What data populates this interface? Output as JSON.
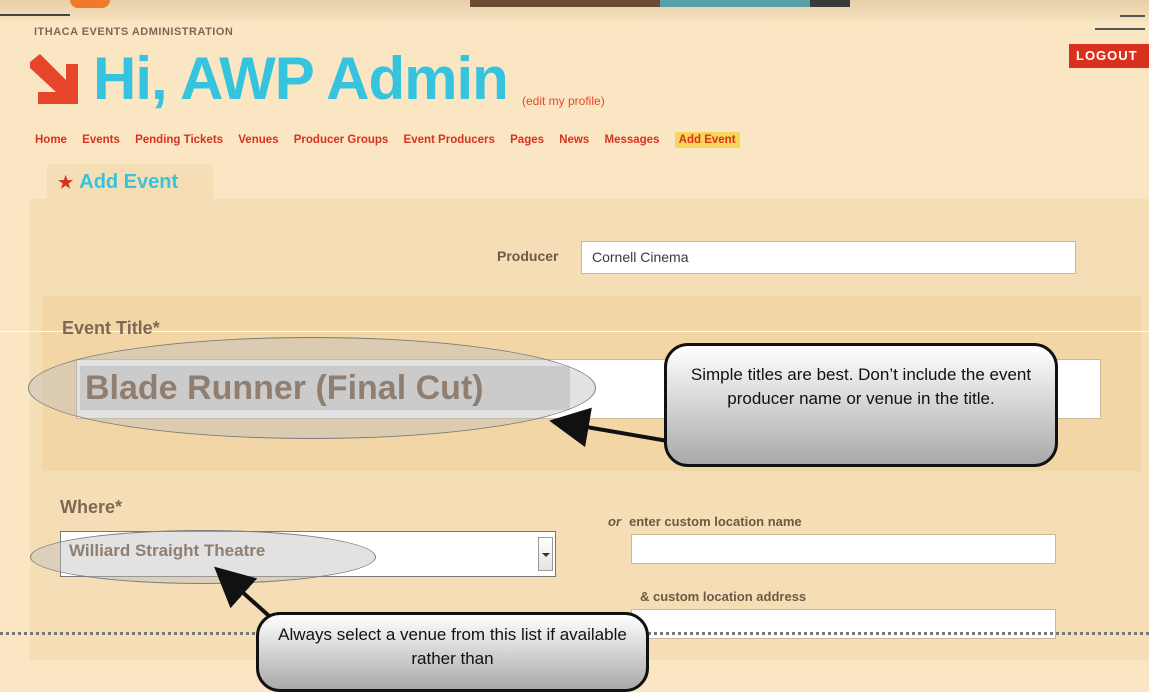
{
  "org_name": "ITHACA EVENTS ADMINISTRATION",
  "logout_label": "LOGOUT",
  "greeting": "Hi, AWP Admin",
  "edit_profile_link": "(edit my profile)",
  "nav": {
    "items": [
      "Home",
      "Events",
      "Pending Tickets",
      "Venues",
      "Producer Groups",
      "Event Producers",
      "Pages",
      "News",
      "Messages"
    ],
    "active": "Add Event"
  },
  "tab": {
    "star": "★",
    "label": "Add Event"
  },
  "form": {
    "producer_label": "Producer",
    "producer_value": "Cornell Cinema",
    "event_title_label": "Event Title*",
    "event_title_value": "Blade Runner (Final Cut)",
    "where_label": "Where*",
    "venue_value": "Williard Straight Theatre",
    "or_word": "or",
    "custom_location_label": "enter custom location name",
    "custom_location_value": "",
    "custom_address_label": "& custom location address",
    "custom_address_value": ""
  },
  "callouts": {
    "title_tip": "Simple titles are best. Don’t include the event producer name or venue in the title.",
    "venue_tip": "Always select a venue from this list if available rather than"
  },
  "colors": {
    "background": "#fbe6c4",
    "accent_blue": "#35c3de",
    "accent_red": "#d8321e",
    "nav_highlight": "#f7d45a"
  }
}
